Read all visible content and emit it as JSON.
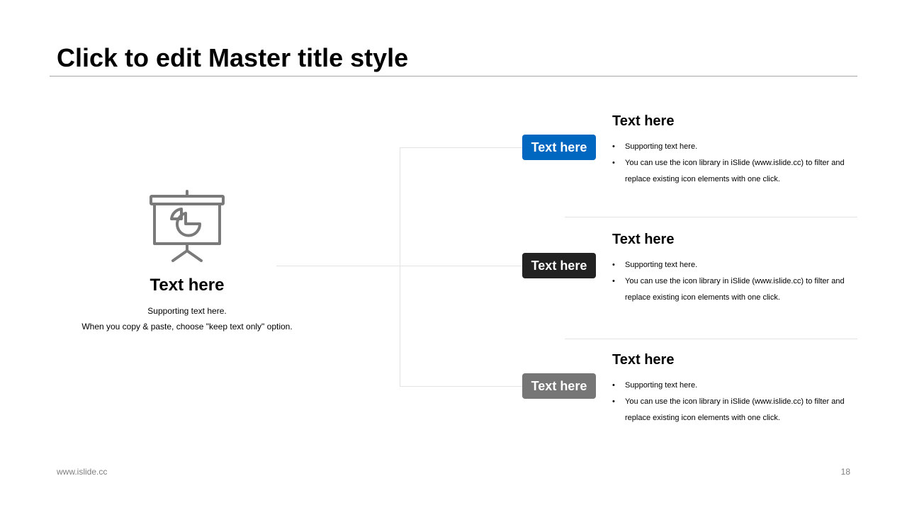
{
  "title": "Click to edit Master title style",
  "left": {
    "icon": "presentation-board-pie-chart-icon",
    "heading": "Text here",
    "support_line1": "Supporting text here.",
    "support_line2": "When you copy & paste, choose \"keep text only\" option."
  },
  "items": [
    {
      "badge": "Text here",
      "badge_color": "#0067c0",
      "title": "Text here",
      "bullet1": "Supporting text here.",
      "bullet2": "You can use the icon library in iSlide  (www.islide.cc) to filter and replace existing icon elements with one click."
    },
    {
      "badge": "Text here",
      "badge_color": "#222222",
      "title": "Text here",
      "bullet1": "Supporting text here.",
      "bullet2": "You can use the icon library in iSlide  (www.islide.cc) to filter and replace existing icon elements with one click."
    },
    {
      "badge": "Text here",
      "badge_color": "#767676",
      "title": "Text here",
      "bullet1": "Supporting text here.",
      "bullet2": "You can use the icon library in iSlide  (www.islide.cc) to filter and replace existing icon elements with one click."
    }
  ],
  "footer": {
    "url": "www.islide.cc",
    "page_number": "18"
  }
}
